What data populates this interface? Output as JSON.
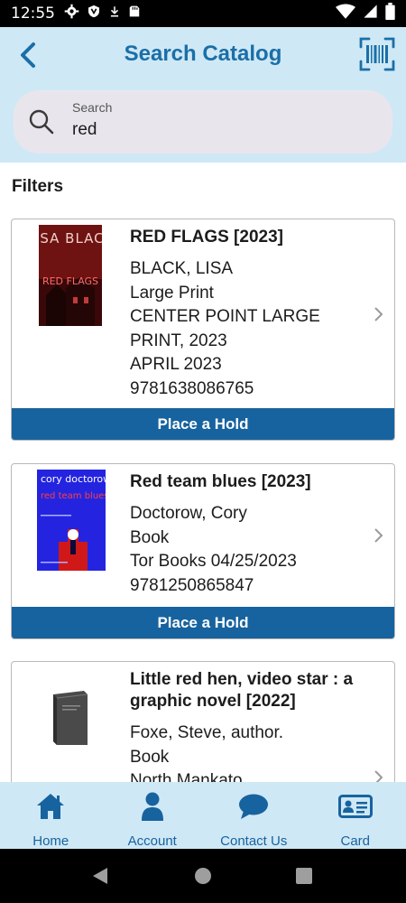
{
  "status_bar": {
    "time": "12:55",
    "left_icons": [
      "gear-icon",
      "shield-icon",
      "download-icon",
      "sd-card-icon"
    ],
    "right_icons": [
      "wifi-icon",
      "signal-icon",
      "battery-icon"
    ]
  },
  "header": {
    "title": "Search Catalog",
    "accent_color": "#1a6fa8",
    "background": "#cfe8f5"
  },
  "search": {
    "label": "Search",
    "value": "red"
  },
  "filters_label": "Filters",
  "results": [
    {
      "title": "RED FLAGS  [2023]",
      "lines": [
        "BLACK, LISA",
        "Large Print",
        "CENTER POINT LARGE PRINT, 2023",
        "APRIL 2023",
        "9781638086765"
      ],
      "cover": {
        "top_text": "LISA BLACK",
        "bottom_text": "RED FLAGS"
      },
      "action": "Place a Hold"
    },
    {
      "title": "Red team blues [2023]",
      "lines": [
        "Doctorow, Cory",
        "Book",
        "Tor Books 04/25/2023",
        "9781250865847"
      ],
      "cover": {
        "top_text": "cory doctorow",
        "bottom_text": "red team blues"
      },
      "action": "Place a Hold"
    },
    {
      "title": "Little red hen, video star : a graphic novel [2022]",
      "lines": [
        "Foxe, Steve, author.",
        "Book",
        "North Mankato"
      ],
      "cover": {
        "placeholder": "generic-book-icon"
      }
    }
  ],
  "bottom_nav": [
    {
      "label": "Home",
      "icon": "home-icon"
    },
    {
      "label": "Account",
      "icon": "person-icon"
    },
    {
      "label": "Contact Us",
      "icon": "chat-bubble-icon"
    },
    {
      "label": "Card",
      "icon": "library-card-icon"
    }
  ],
  "colors": {
    "button": "#17639f",
    "nav_text": "#17639f"
  }
}
